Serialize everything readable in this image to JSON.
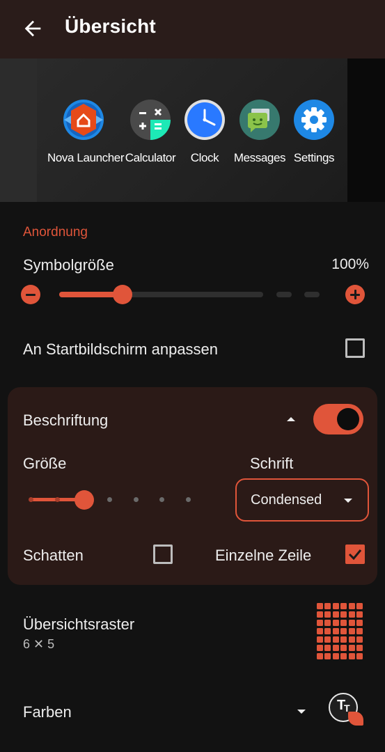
{
  "appbar": {
    "title": "Übersicht"
  },
  "preview": {
    "apps": [
      {
        "label": "Nova Launcher",
        "icon": "nova-launcher-icon"
      },
      {
        "label": "Calculator",
        "icon": "calculator-icon"
      },
      {
        "label": "Clock",
        "icon": "clock-icon"
      },
      {
        "label": "Messages",
        "icon": "messages-icon"
      },
      {
        "label": "Settings",
        "icon": "settings-icon"
      }
    ]
  },
  "layout_section": {
    "title": "Anordnung",
    "icon_size": {
      "label": "Symbolgröße",
      "value": "100%",
      "slider_fraction": 0.3
    },
    "fit_home": {
      "label": "An Startbildschirm anpassen",
      "checked": false
    }
  },
  "labels_card": {
    "title": "Beschriftung",
    "enabled": true,
    "size_label": "Größe",
    "size_level": 3,
    "size_levels": 7,
    "font_label": "Schrift",
    "font_value": "Condensed",
    "shadow": {
      "label": "Schatten",
      "checked": false
    },
    "single_line": {
      "label": "Einzelne Zeile",
      "checked": true
    }
  },
  "grid": {
    "label": "Übersichtsraster",
    "value": "6 ✕ 5"
  },
  "colors": {
    "label": "Farben"
  },
  "theme": {
    "accent": "#e0553a",
    "appbar": "#2a1c1a",
    "card": "#2b1a17",
    "background": "#121212"
  }
}
